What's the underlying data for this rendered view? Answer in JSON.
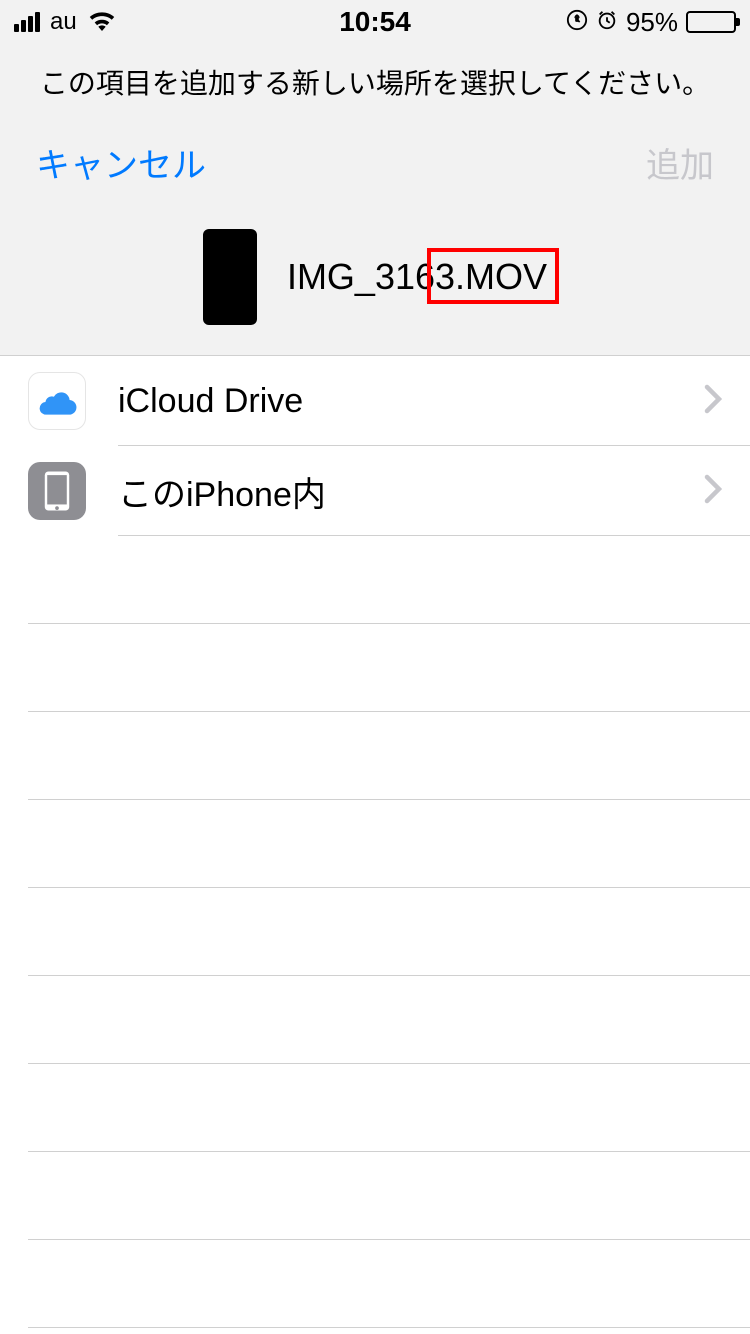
{
  "statusBar": {
    "carrier": "au",
    "time": "10:54",
    "battery": "95%"
  },
  "header": {
    "prompt": "この項目を追加する新しい場所を選択してください。",
    "cancel": "キャンセル",
    "add": "追加"
  },
  "file": {
    "name": "IMG_3163.MOV"
  },
  "locations": [
    {
      "label": "iCloud Drive",
      "icon": "icloud"
    },
    {
      "label": "このiPhone内",
      "icon": "phone"
    }
  ]
}
